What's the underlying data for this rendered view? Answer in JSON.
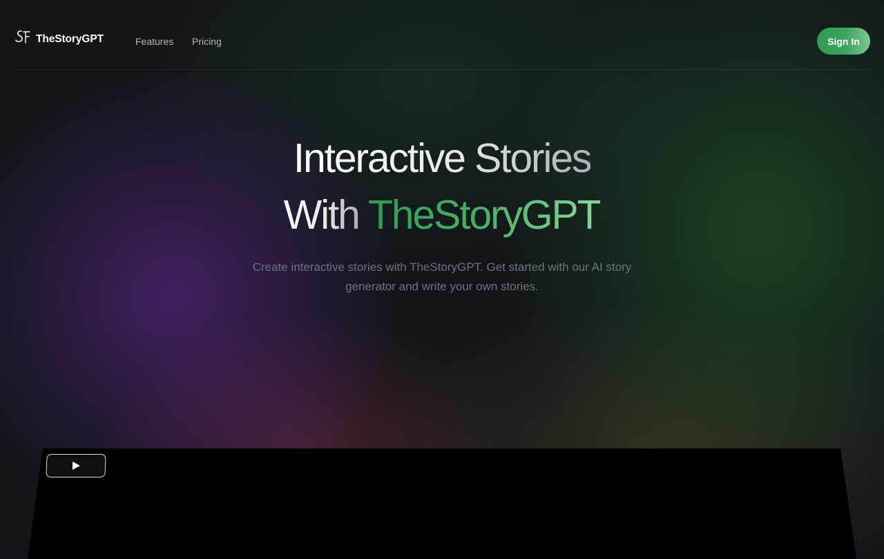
{
  "brand": {
    "name": "TheStoryGPT",
    "logo_icon": "sf-monogram-icon"
  },
  "nav": {
    "links": [
      {
        "label": "Features"
      },
      {
        "label": "Pricing"
      }
    ],
    "signin_label": "Sign In"
  },
  "hero": {
    "title_line1": "Interactive Stories",
    "title_line2_prefix": "With",
    "title_line2_highlight": "TheStoryGPT",
    "subtitle": "Create interactive stories with TheStoryGPT. Get started with our AI story generator and write your own stories."
  },
  "video": {
    "play_icon": "play-icon"
  },
  "colors": {
    "accent": "#3ea45f",
    "background": "#121519"
  }
}
